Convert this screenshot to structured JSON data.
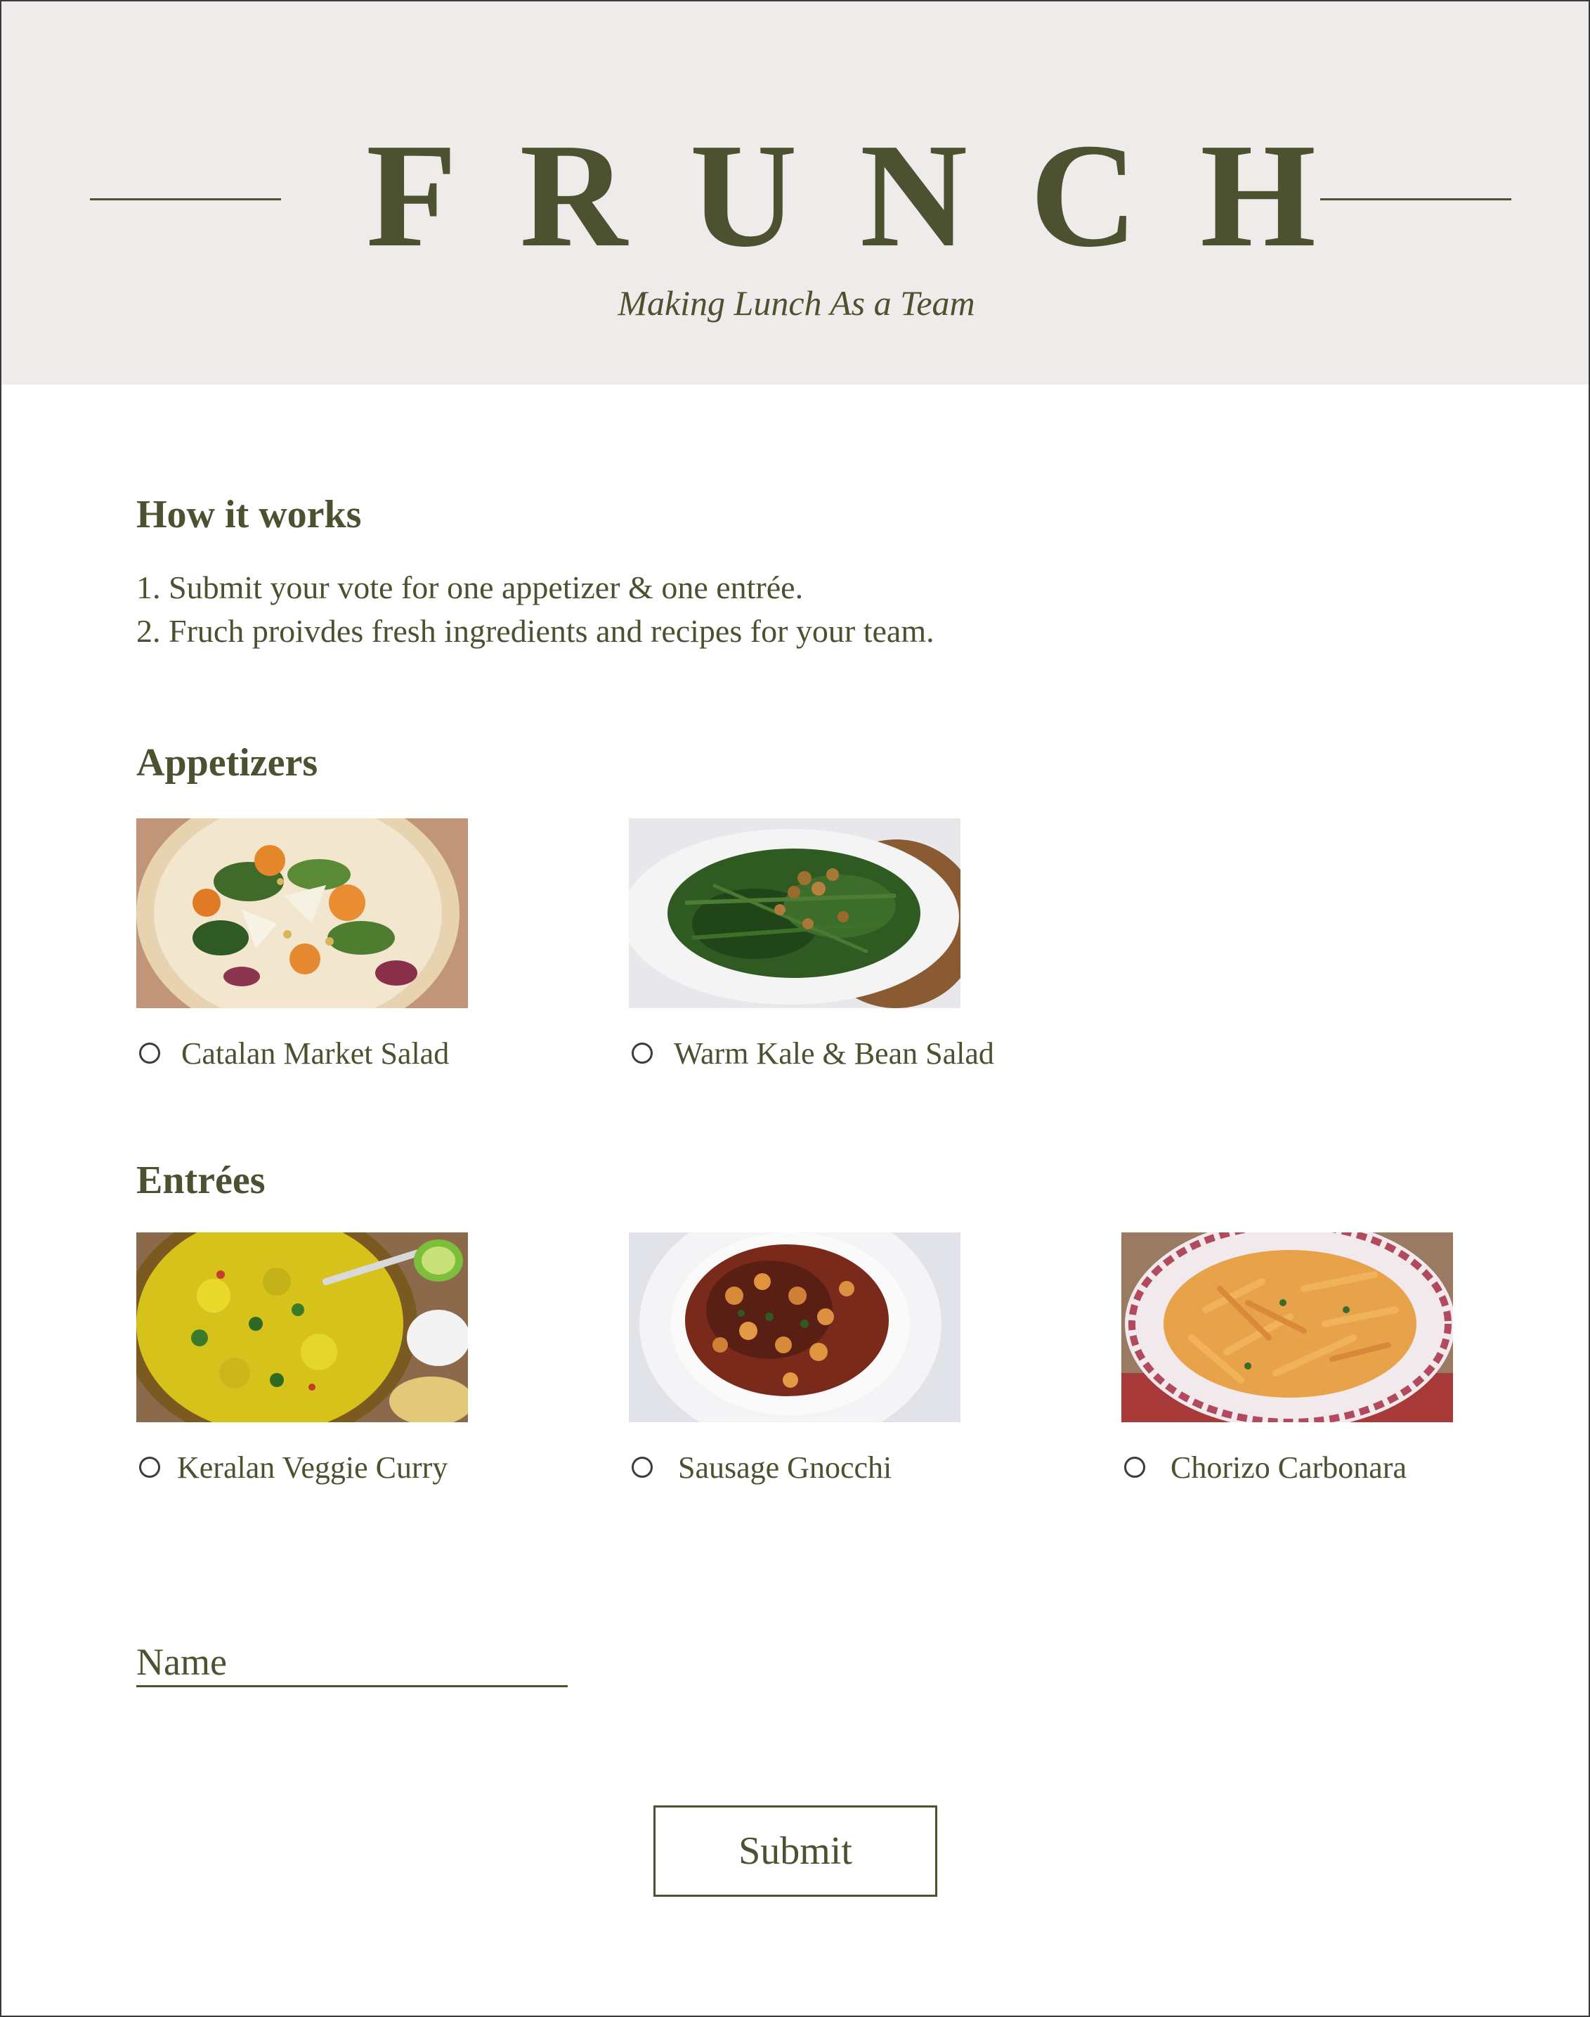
{
  "header": {
    "brand": "FRUNCH",
    "tagline": "Making Lunch As a Team"
  },
  "how_it_works": {
    "title": "How it works",
    "steps": [
      "1. Submit your vote for one appetizer & one entrée.",
      "2. Fruch proivdes fresh ingredients and recipes for your team."
    ]
  },
  "appetizers": {
    "title": "Appetizers",
    "items": [
      {
        "label": "Catalan Market Salad",
        "selected": false
      },
      {
        "label": "Warm Kale & Bean Salad",
        "selected": false
      }
    ]
  },
  "entrees": {
    "title": "Entrées",
    "items": [
      {
        "label": "Keralan Veggie Curry",
        "selected": false
      },
      {
        "label": "Sausage Gnocchi",
        "selected": false
      },
      {
        "label": "Chorizo Carbonara",
        "selected": false
      }
    ]
  },
  "form": {
    "name_placeholder": "Name",
    "name_value": "",
    "submit_label": "Submit"
  },
  "colors": {
    "accent": "#4c5230",
    "header_bg": "#eeebea",
    "border": "#3a3a3a"
  }
}
